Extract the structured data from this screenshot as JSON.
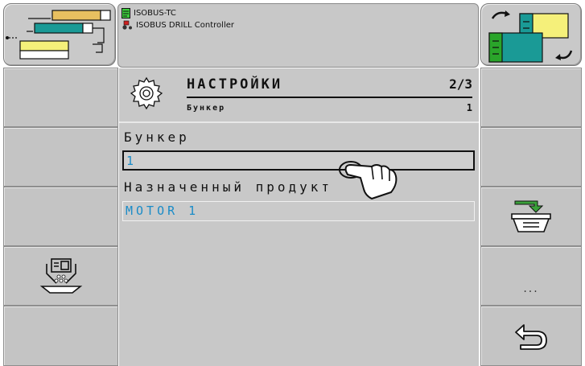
{
  "header": {
    "app_name": "ISOBUS-TC",
    "controller_name": "ISOBUS DRILL Controller"
  },
  "mask": {
    "title": "НАСТРОЙКИ",
    "page": "2/3",
    "subtitle": "Бункер",
    "subtitle_value": "1",
    "fields": [
      {
        "label": "Бункер",
        "value": "1"
      },
      {
        "label": "Назначенный продукт",
        "value": "MOTOR 1"
      }
    ]
  },
  "softkeys": {
    "more_label": "..."
  },
  "colors": {
    "background": "#c8c8c8",
    "value_text": "#1a8cc8",
    "product_yellow": "#f5f07a",
    "product_teal": "#1a9a96",
    "product_green": "#2aa52a"
  },
  "icons": {
    "top_left": "boom-sections-icon",
    "top_right": "swap-product-icon",
    "header_app": "document-icon",
    "header_controller": "tractor-icon",
    "mask": "gear-icon",
    "left_softkey_4": "metering-unit-icon",
    "right_softkey_3": "assign-product-icon",
    "right_softkey_5": "back-icon",
    "cursor": "hand-pointer-icon"
  }
}
